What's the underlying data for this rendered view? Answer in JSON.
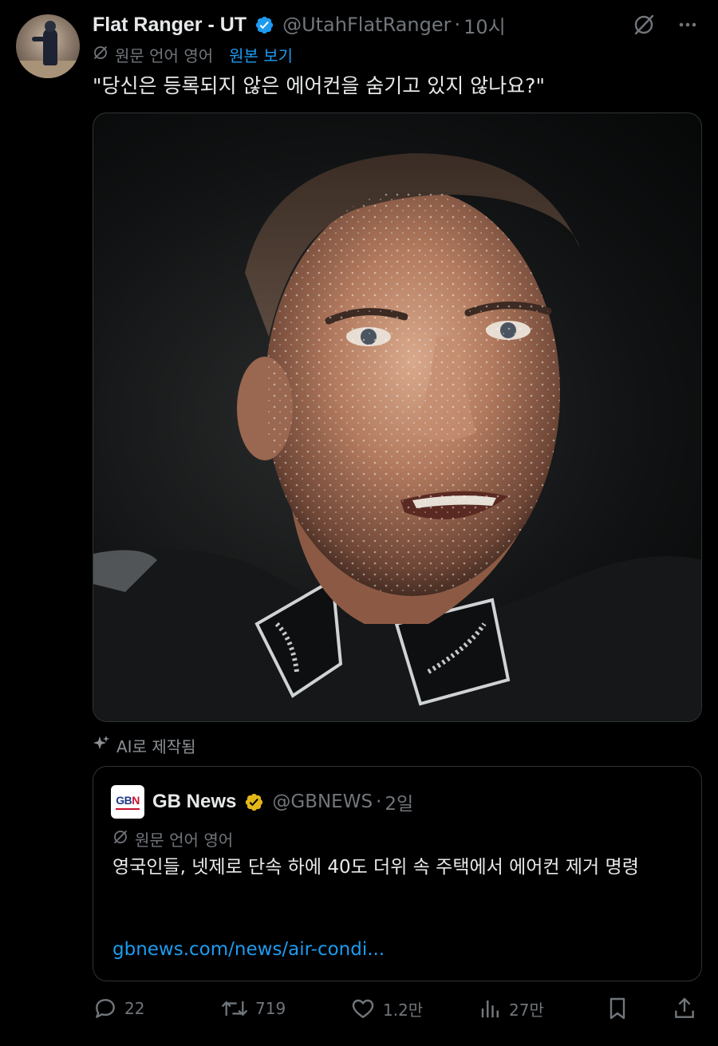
{
  "tweet": {
    "author": {
      "name": "Flat Ranger - UT",
      "handle": "@UtahFlatRanger",
      "time": "10시"
    },
    "translation": {
      "label": "원문 언어 영어",
      "view_original": "원본 보기"
    },
    "text": "\"당신은 등록되지 않은 에어컨을 숨기고 있지 않나요?\"",
    "media_label": "AI로 제작됨"
  },
  "quote": {
    "logo_text": "GBN",
    "name": "GB News",
    "handle": "@GBNEWS",
    "time": "2일",
    "translation_label": "원문 언어 영어",
    "text": "영국인들, 넷제로 단속 하에 40도 더위 속 주택에서 에어컨 제거 명령",
    "link": "gbnews.com/news/air-condi..."
  },
  "actions": {
    "replies": "22",
    "retweets": "719",
    "likes": "1.2만",
    "views": "27만"
  },
  "colors": {
    "background": "#000000",
    "text": "#e7e9ea",
    "muted": "#71767b",
    "link": "#1d9bf0",
    "verified_blue": "#1d9bf0",
    "verified_gold": "#e2b719",
    "border": "#2f3336"
  },
  "icons": [
    "verified-badge-icon",
    "grok-icon",
    "more-icon",
    "translate-icon",
    "ai-sparkle-icon",
    "reply-icon",
    "retweet-icon",
    "like-icon",
    "views-icon",
    "bookmark-icon",
    "share-icon"
  ]
}
